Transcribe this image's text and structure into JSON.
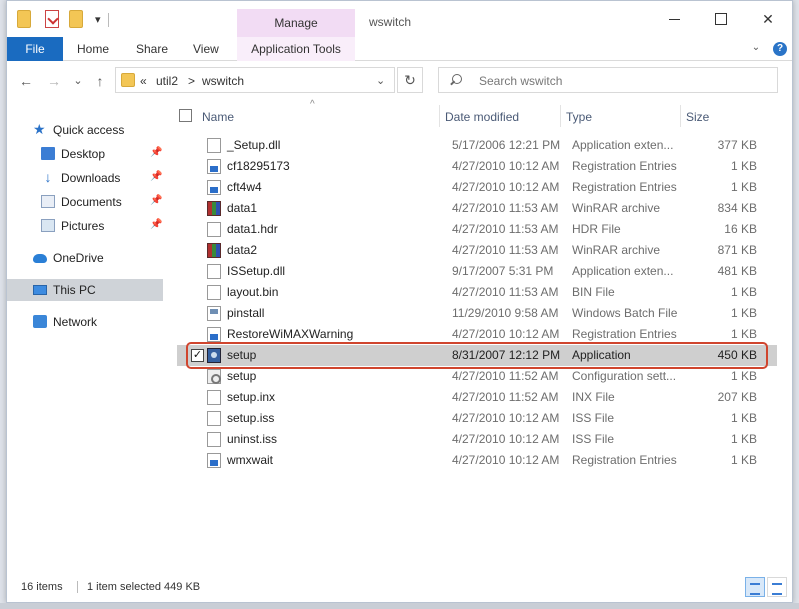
{
  "window": {
    "title": "wswitch",
    "manage_label": "Manage",
    "qa_dropdown": "▾",
    "controls": {
      "minimize": "",
      "maximize": "",
      "close": "✕"
    }
  },
  "ribbon": {
    "tabs": [
      "File",
      "Home",
      "Share",
      "View",
      "Application Tools"
    ],
    "collapse": "⌄",
    "help": "?"
  },
  "nav": {
    "back": "←",
    "forward": "→",
    "recent": "⌄",
    "up": "↑",
    "breadcrumb_overflow": "«",
    "breadcrumb": [
      "util2",
      "wswitch"
    ],
    "breadcrumb_sep": ">",
    "address_dropdown": "⌄",
    "refresh": "↻",
    "search_placeholder": "Search wswitch"
  },
  "sidebar": {
    "items": [
      {
        "label": "Quick access",
        "icon": "star-icon",
        "pinned": false
      },
      {
        "label": "Desktop",
        "icon": "desktop-icon",
        "pinned": true
      },
      {
        "label": "Downloads",
        "icon": "download-icon",
        "pinned": true
      },
      {
        "label": "Documents",
        "icon": "documents-icon",
        "pinned": true
      },
      {
        "label": "Pictures",
        "icon": "pictures-icon",
        "pinned": true
      },
      {
        "label": "OneDrive",
        "icon": "cloud-icon",
        "pinned": false
      },
      {
        "label": "This PC",
        "icon": "computer-icon",
        "pinned": false,
        "active": true
      },
      {
        "label": "Network",
        "icon": "network-icon",
        "pinned": false
      }
    ],
    "pin_glyph": "📌"
  },
  "columns": {
    "name": "Name",
    "date": "Date modified",
    "type": "Type",
    "size": "Size",
    "sort_indicator": "^"
  },
  "files": [
    {
      "name": "_Setup.dll",
      "date": "5/17/2006 12:21 PM",
      "type": "Application exten...",
      "size": "377 KB",
      "icon": "doc-icon"
    },
    {
      "name": "cf18295173",
      "date": "4/27/2010 10:12 AM",
      "type": "Registration Entries",
      "size": "1 KB",
      "icon": "registry-icon"
    },
    {
      "name": "cft4w4",
      "date": "4/27/2010 10:12 AM",
      "type": "Registration Entries",
      "size": "1 KB",
      "icon": "registry-icon"
    },
    {
      "name": "data1",
      "date": "4/27/2010 11:53 AM",
      "type": "WinRAR archive",
      "size": "834 KB",
      "icon": "winrar-icon"
    },
    {
      "name": "data1.hdr",
      "date": "4/27/2010 11:53 AM",
      "type": "HDR File",
      "size": "16 KB",
      "icon": "doc-icon"
    },
    {
      "name": "data2",
      "date": "4/27/2010 11:53 AM",
      "type": "WinRAR archive",
      "size": "871 KB",
      "icon": "winrar-icon"
    },
    {
      "name": "ISSetup.dll",
      "date": "9/17/2007 5:31 PM",
      "type": "Application exten...",
      "size": "481 KB",
      "icon": "doc-icon"
    },
    {
      "name": "layout.bin",
      "date": "4/27/2010 11:53 AM",
      "type": "BIN File",
      "size": "1 KB",
      "icon": "doc-icon"
    },
    {
      "name": "pinstall",
      "date": "11/29/2010 9:58 AM",
      "type": "Windows Batch File",
      "size": "1 KB",
      "icon": "batch-icon"
    },
    {
      "name": "RestoreWiMAXWarning",
      "date": "4/27/2010 10:12 AM",
      "type": "Registration Entries",
      "size": "1 KB",
      "icon": "registry-icon"
    },
    {
      "name": "setup",
      "date": "8/31/2007 12:12 PM",
      "type": "Application",
      "size": "450 KB",
      "icon": "application-icon",
      "selected": true
    },
    {
      "name": "setup",
      "date": "4/27/2010 11:52 AM",
      "type": "Configuration sett...",
      "size": "1 KB",
      "icon": "config-icon"
    },
    {
      "name": "setup.inx",
      "date": "4/27/2010 11:52 AM",
      "type": "INX File",
      "size": "207 KB",
      "icon": "doc-icon"
    },
    {
      "name": "setup.iss",
      "date": "4/27/2010 10:12 AM",
      "type": "ISS File",
      "size": "1 KB",
      "icon": "doc-icon"
    },
    {
      "name": "uninst.iss",
      "date": "4/27/2010 10:12 AM",
      "type": "ISS File",
      "size": "1 KB",
      "icon": "doc-icon"
    },
    {
      "name": "wmxwait",
      "date": "4/27/2010 10:12 AM",
      "type": "Registration Entries",
      "size": "1 KB",
      "icon": "registry-icon"
    }
  ],
  "selected_check": "✓",
  "status": {
    "count": "16 items",
    "selection": "1 item selected  449 KB"
  },
  "colors": {
    "accent": "#1a6bc0",
    "manage_tab": "#f2dcf4",
    "highlight_border": "#d0452e",
    "selected_row": "#cfcfcf"
  }
}
